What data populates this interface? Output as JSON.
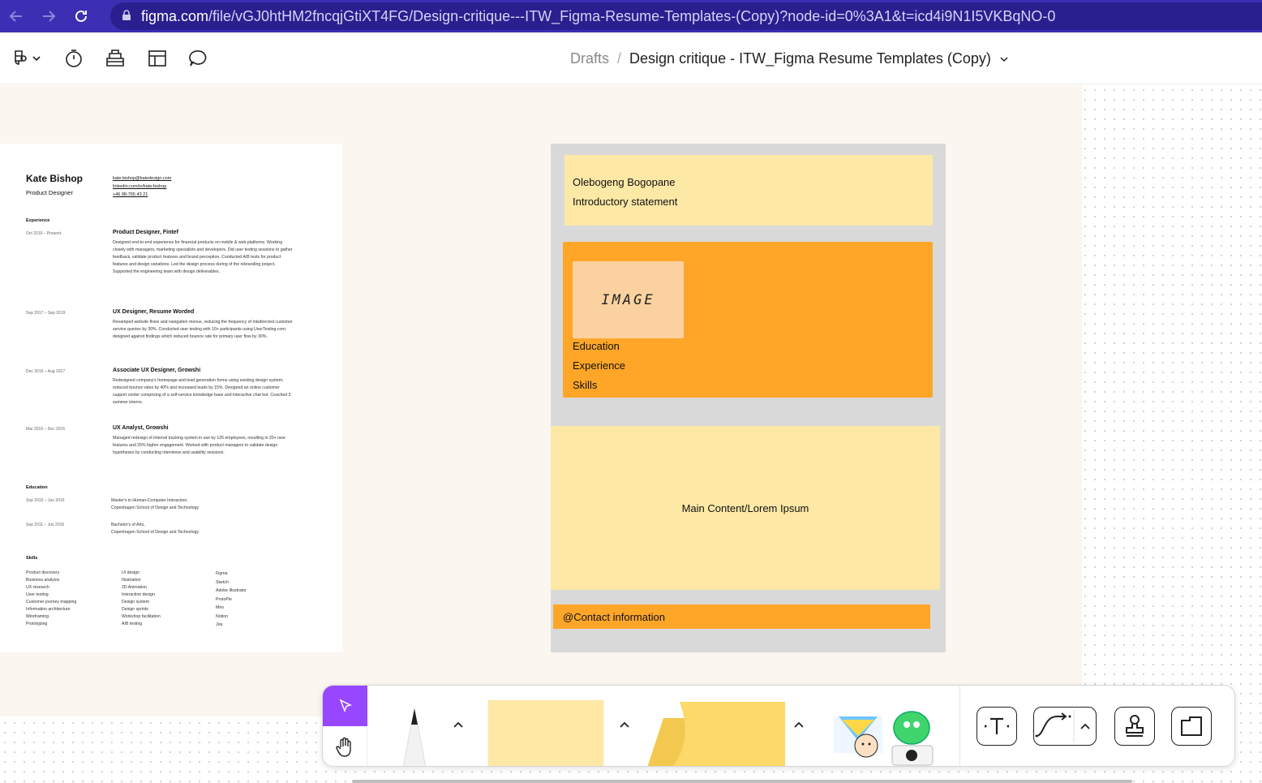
{
  "browser": {
    "url_host": "figma.com",
    "url_path": "/file/vGJ0htHM2fncqjGtiXT4FG/Design-critique---ITW_Figma-Resume-Templates-(Copy)?node-id=0%3A1&t=icd4i9N1I5VKBqNO-0"
  },
  "toolbar": {
    "breadcrumb_root": "Drafts",
    "breadcrumb_sep": "/",
    "file_title": "Design critique - ITW_Figma Resume Templates (Copy)"
  },
  "resume": {
    "name": "Kate Bishop",
    "role": "Product Designer",
    "email": "kate.bishop@katedesign.com",
    "linkedin": "linkedin.com/in/kate-bishop",
    "phone": "+46 98-765 43 21",
    "experience_heading": "Experience",
    "jobs": [
      {
        "dates": "Oct 2019 – Present",
        "title": "Product Designer, Fintef",
        "desc": "Designed end-to-end experience for financial products on mobile & web platforms. Working closely with managers, marketing specialists and developers. Did user testing sessions to gather feedback, validate product features and brand perception. Conducted A/B tests for product features and design variations. Led the design process during of the rebranding project. Supported the engineering team with design deliverables."
      },
      {
        "dates": "Sep 2017 – Sep 2019",
        "title": "UX Designer, Resume Worded",
        "desc": "Revamped website flows and navigation menus, reducing the frequency of misdirected customer service queries by 30%. Conducted user testing with 10+ participants using UserTesting.com; designed against findings which reduced bounce rate for primary user flow by 30%."
      },
      {
        "dates": "Dec 2016 – Aug 2017",
        "title": "Associate UX Designer, Growshi",
        "desc": "Redesigned company's homepage and lead generation forms using existing design system; reduced bounce rates by 40% and increased leads by 15%. Designed an online customer support center comprising of a self-service knowledge base and interactive chat bot. Coached 3 summer interns."
      },
      {
        "dates": "Mar 2016 – Dec 2016",
        "title": "UX Analyst, Growshi",
        "desc": "Managed redesign of internal tracking system in use by 125 employees, resulting in 20+ new features and 25% higher engagement. Worked with product managers to validate design hypotheses by conducting interviews and usability sessions."
      }
    ],
    "education_heading": "Education",
    "education": [
      {
        "dates": "Sep 2015 – Jun 2016",
        "degree": "Master's in Human-Computer Interaction,",
        "school": "Copenhagen School of Design and Technology"
      },
      {
        "dates": "Sep 2011 – Jun 2015",
        "degree": "Bachelor's of Arts,",
        "school": "Copenhagen School of Design and Technology"
      }
    ],
    "skills_heading": "Skills",
    "skills_col1": [
      "Product discovery",
      "Business analysis",
      "UX research",
      "User testing",
      "Customer journey mapping",
      "Information architecture",
      "Wireframing",
      "Prototyping"
    ],
    "skills_col2": [
      "UI design",
      "Illustration",
      "2D Animation",
      "Interaction design",
      "Design system",
      "Design sprints",
      "Workshop facilitation",
      "A/B testing"
    ],
    "skills_col3": [
      "Figma",
      "Sketch",
      "Adobe Illustrator",
      "ProtoPie",
      "Miro",
      "Notion",
      "Jira"
    ]
  },
  "wireframe": {
    "name": "Olebogeng Bogopane",
    "intro": "Introductory statement",
    "image_label": "IMAGE",
    "education": "Education",
    "experience": "Experience",
    "skills": "Skills",
    "main_content": "Main Content/Lorem Ipsum",
    "contact": "@Contact information"
  },
  "colors": {
    "browser_bar": "#3c2fb4",
    "accent_purple": "#9747ff",
    "sticky_yellow": "#fee8a6",
    "sticky_orange": "#ffa629",
    "image_peach": "#fbd29f",
    "section_bg": "#fbf6ef"
  },
  "icons": {
    "back": "arrow-left-icon",
    "forward": "arrow-right-icon",
    "reload": "reload-icon",
    "lock": "lock-icon",
    "figma_menu": "figma-logo-icon",
    "timer": "timer-icon",
    "library": "library-icon",
    "layout": "layout-icon",
    "comment": "comment-icon",
    "chevron": "chevron-down-icon"
  }
}
